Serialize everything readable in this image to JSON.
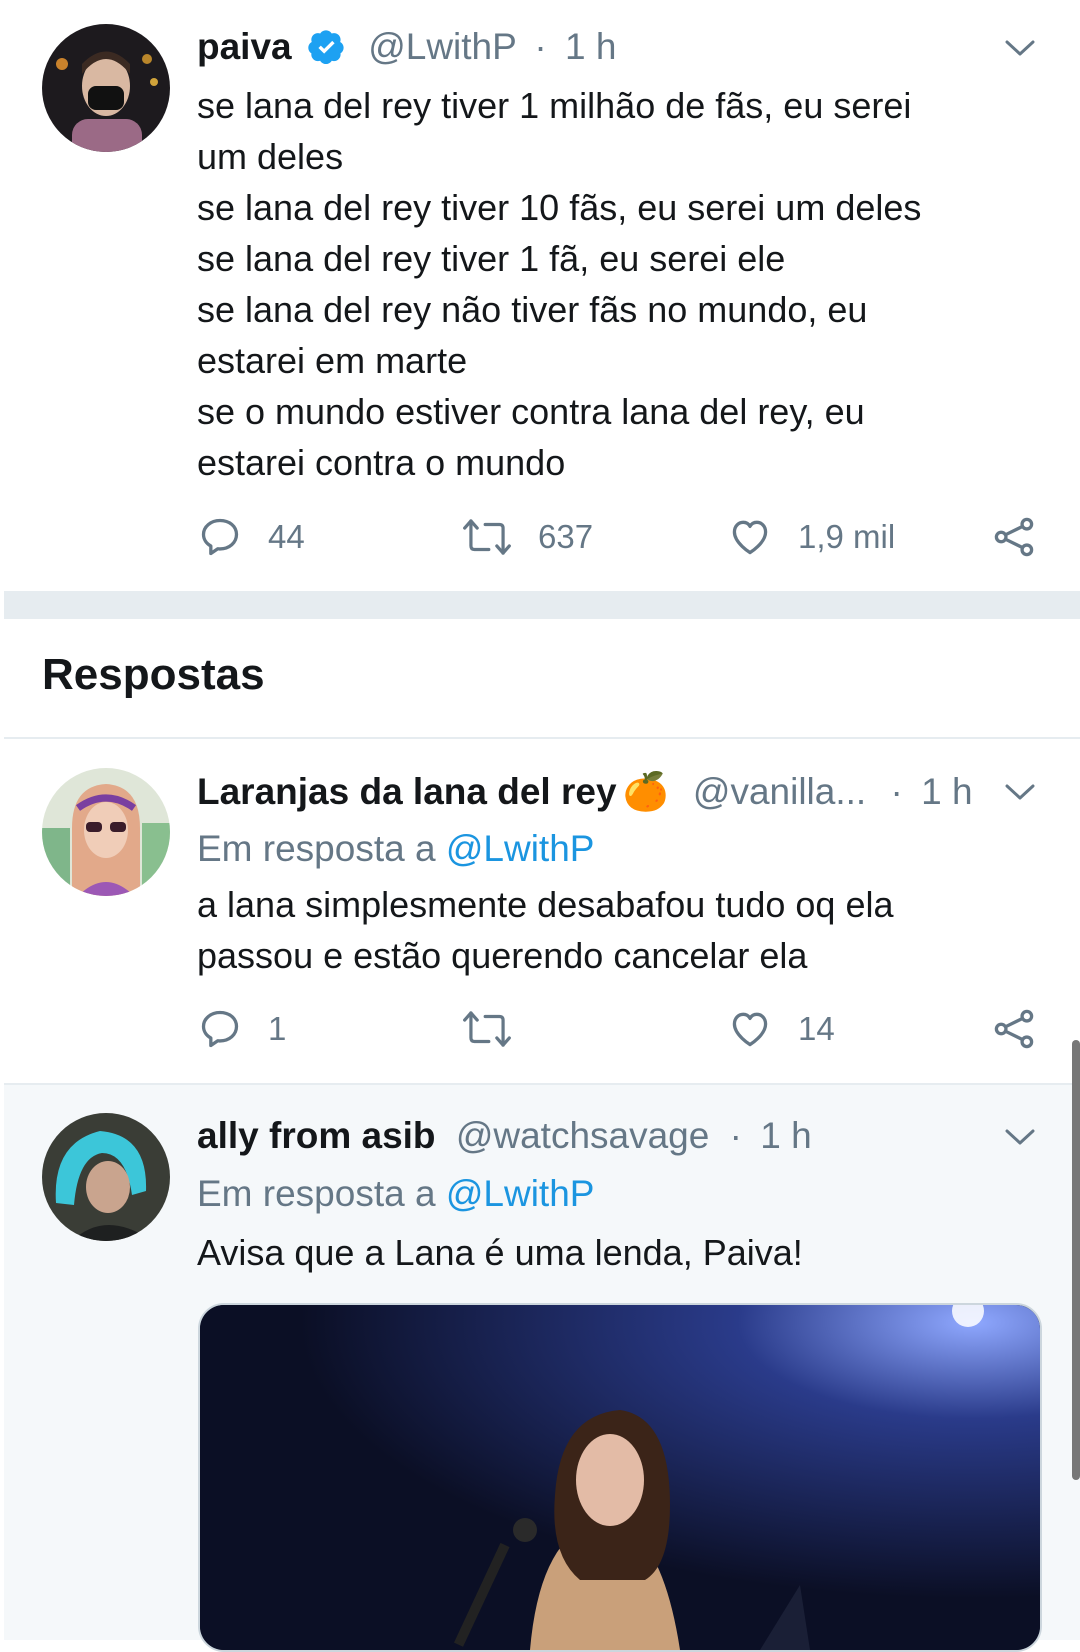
{
  "main_tweet": {
    "name": "paiva",
    "handle": "@LwithP",
    "separator": "·",
    "time": "1 h",
    "lines": [
      "se lana del rey tiver 1 milhão de fãs, eu serei",
      "um deles",
      "se lana del rey tiver 10 fãs, eu serei um deles",
      "se lana del rey tiver 1 fã, eu serei ele",
      "se lana del rey não tiver fãs no mundo, eu",
      "estarei em marte",
      "se o mundo estiver contra lana del rey, eu",
      "estarei contra o mundo"
    ],
    "replies": "44",
    "retweets": "637",
    "likes": "1,9 mil"
  },
  "section": {
    "title": "Respostas"
  },
  "reply1": {
    "name": "Laranjas da lana del rey",
    "emoji": "🍊",
    "handle": "@vanilla...",
    "separator": "·",
    "time": "1 h",
    "reply_prefix": "Em resposta a",
    "reply_mention": "@LwithP",
    "lines": [
      "a lana simplesmente desabafou tudo oq ela",
      "passou e estão querendo cancelar ela"
    ],
    "replies": "1",
    "retweets": "",
    "likes": "14"
  },
  "reply2": {
    "name": "ally from asib",
    "handle": "@watchsavage",
    "separator": "·",
    "time": "1 h",
    "reply_prefix": "Em resposta a",
    "reply_mention": "@LwithP",
    "text": "Avisa que a Lana é uma lenda, Paiva!"
  },
  "colors": {
    "accent": "#1b95e0",
    "verified": "#1da1f2",
    "muted": "#657786",
    "divider": "#e6ecf0"
  }
}
